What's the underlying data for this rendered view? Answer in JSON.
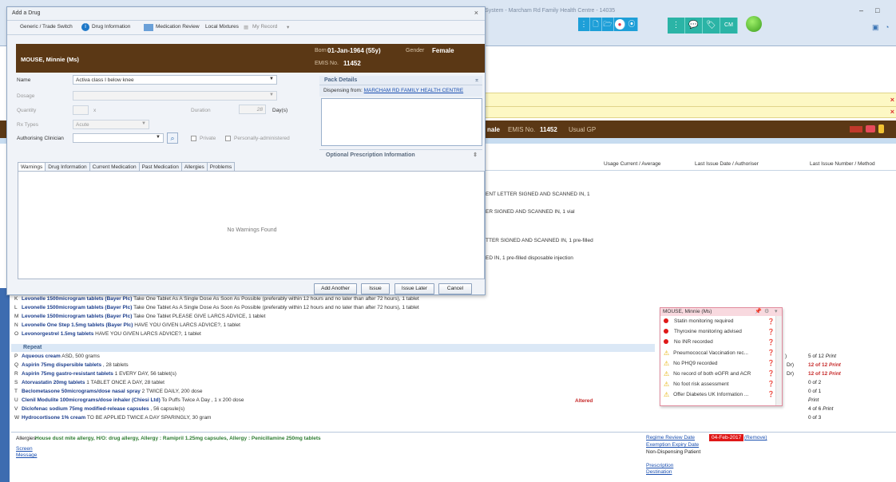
{
  "window": {
    "title": "Care System - Marcham Rd Family Health Centre - 14035",
    "min": "–",
    "max": "□"
  },
  "toolbar_right": [
    "▤",
    "▢",
    "🗀",
    "●",
    "⦿"
  ],
  "toolbar_green": [
    "⋮",
    "💬",
    "🏷",
    "CM"
  ],
  "patient_banner": {
    "name_suffix": "nale",
    "emis_label": "EMIS No.",
    "emis": "11452",
    "usual_gp": "Usual GP"
  },
  "columns": {
    "usage": "Usage Current / Average",
    "last_issue": "Last Issue Date / Authoriser",
    "last_num": "Last Issue Number / Method"
  },
  "bg_lines": [
    "ENT LETTER SIGNED AND SCANNED IN, 1",
    "ER SIGNED AND SCANNED IN, 1 vial",
    "TTER SIGNED AND SCANNED IN, 1 pre-filled",
    "ED IN, 1 pre-filled disposable injection"
  ],
  "dialog": {
    "title": "Add a Drug",
    "close": "×",
    "tools": {
      "generic": "Generic / Trade Switch",
      "druginfo": "Drug Information",
      "medreview": "Medication Review",
      "local": "Local Mixtures",
      "myrecord": "My Record"
    },
    "patient": {
      "name": "MOUSE, Minnie (Ms)",
      "born_label": "Born",
      "born": "01-Jan-1964 (55y)",
      "gender_label": "Gender",
      "gender": "Female",
      "emis_label": "EMIS No.",
      "emis": "11452"
    },
    "fields": {
      "name_label": "Name",
      "name_value": "Activa class I below knee",
      "dosage_label": "Dosage",
      "quantity_label": "Quantity",
      "quantity_unit": "x",
      "duration_label": "Duration",
      "duration_value": "28",
      "duration_unit": "Day(s)",
      "rxtype_label": "Rx Types",
      "rxtype_value": "Acute",
      "auth_label": "Authorising Clinician",
      "private_label": "Private",
      "personal_label": "Personally-administered"
    },
    "pack": {
      "title": "Pack Details",
      "disp_label": "Dispensing from:",
      "disp_value": "MARCHAM RD FAMILY HEALTH CENTRE"
    },
    "optional": "Optional Prescription Information",
    "tabs": [
      "Warnings",
      "Drug Information",
      "Current Medication",
      "Past Medication",
      "Allergies",
      "Problems"
    ],
    "no_warnings": "No Warnings Found",
    "buttons": {
      "add": "Add Another",
      "issue": "Issue",
      "later": "Issue Later",
      "cancel": "Cancel"
    }
  },
  "side_tab": "View -> My Record (No sh",
  "acute_rows": [
    {
      "l": "K",
      "drug": "Levonelle 1500microgram tablets (Bayer Plc)",
      "rest": " Take One Tablet As A Single Dose As Soon As Possible (preferably within 12 hours and no later than after 72 hours), 1 tablet"
    },
    {
      "l": "L",
      "drug": "Levonelle 1500microgram tablets (Bayer Plc)",
      "rest": " Take One Tablet As A Single Dose As Soon As Possible (preferably within 12 hours and no later than after 72 hours), 1 tablet"
    },
    {
      "l": "M",
      "drug": "Levonelle 1500microgram tablets (Bayer Plc)",
      "rest": " Take One Tablet PLEASE GIVE LARCS ADVICE, 1 tablet"
    },
    {
      "l": "N",
      "drug": "Levonelle One Step 1.5mg tablets (Bayer Plc)",
      "rest": " HAVE YOU GIVEN LARCS ADVICE?, 1 tablet"
    },
    {
      "l": "O",
      "drug": "Levonorgestrel 1.5mg tablets",
      "rest": " HAVE YOU GIVEN LARCS ADVICE?, 1 tablet"
    }
  ],
  "repeat_label": "Repeat",
  "repeat_rows": [
    {
      "l": "P",
      "drug": "Aqueous cream",
      "rest": " ASD, 500 grams",
      "issue": "5 of 12",
      "method": "Print",
      "red": false
    },
    {
      "l": "Q",
      "drug": "Aspirin 75mg dispersible tablets",
      "rest": " , 28 tablets",
      "issue": "12 of 12",
      "method": "Print",
      "red": true
    },
    {
      "l": "R",
      "drug": "Aspirin 75mg gastro-resistant tablets",
      "rest": " 1 EVERY DAY, 56 tablet(s)",
      "issue": "12 of 12",
      "method": "Print",
      "red": true
    },
    {
      "l": "S",
      "drug": "Atorvastatin 20mg tablets",
      "rest": " 1 TABLET ONCE A DAY, 28 tablet",
      "issue": "0 of 2",
      "method": "",
      "red": false
    },
    {
      "l": "T",
      "drug": "Beclometasone 50micrograms/dose nasal spray",
      "rest": " 2 TWICE DAILY, 200 dose",
      "issue": "0 of 1",
      "method": "",
      "red": false
    },
    {
      "l": "U",
      "drug": "Clenil Modulite 100micrograms/dose inhaler (Chiesi Ltd)",
      "rest": " To Puffs Twice A Day , 1 x 200 dose",
      "issue": "",
      "method": "Print",
      "red": false
    },
    {
      "l": "V",
      "drug": "Diclofenac sodium 75mg modified-release capsules",
      "rest": " , 56 capsule(s)",
      "issue": "4 of 6",
      "method": "Print",
      "red": false
    },
    {
      "l": "W",
      "drug": "Hydrocortisone 1% cream",
      "rest": " TO BE APPLIED TWICE A DAY SPARINGLY, 30 gram",
      "issue": "0 of 3",
      "method": "",
      "red": false
    }
  ],
  "altered": "Altered",
  "dr1": "Dr)",
  "dr2": "Dr)",
  "paren": ")",
  "popup": {
    "title": "MOUSE, Minnie (Ms)",
    "items": [
      {
        "t": "Statin monitoring required",
        "k": "dot"
      },
      {
        "t": "Thyroxine monitoring advised",
        "k": "dot"
      },
      {
        "t": "No INR recorded",
        "k": "dot"
      },
      {
        "t": "Pneumococcal Vaccination rec...",
        "k": "tri"
      },
      {
        "t": "No PHQ9 recorded",
        "k": "tri"
      },
      {
        "t": "No record of both eGFR and ACR",
        "k": "tri"
      },
      {
        "t": "No foot risk assessment",
        "k": "tri"
      },
      {
        "t": "Offer Diabetes UK Information ...",
        "k": "tri"
      }
    ]
  },
  "allergies": {
    "label": "Allergies",
    "value": "House dust mite allergy, H/O: drug allergy, Allergy : Ramipril 1.25mg capsules, Allergy : Penicillamine 250mg tablets"
  },
  "screen_msg": [
    "Screen",
    "Message"
  ],
  "regime": {
    "label": "Regime Review Date",
    "date": "04-Feb-2017",
    "remove": "(Remove)",
    "exemption": "Exemption Expiry Date",
    "nondisp": "Non-Dispensing Patient",
    "presc1": "Prescription",
    "presc2": "Destination"
  }
}
